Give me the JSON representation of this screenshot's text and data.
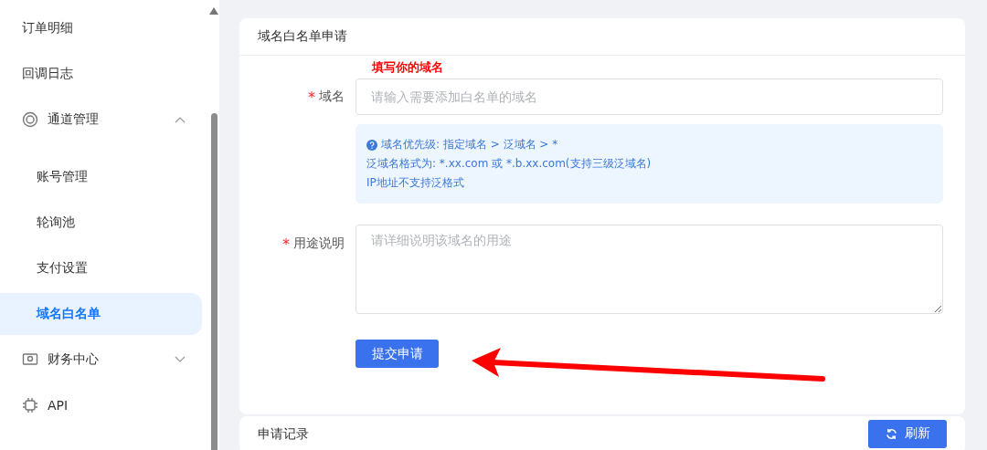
{
  "sidebar": {
    "items": [
      {
        "kind": "link",
        "label": "订单明细",
        "selected": false
      },
      {
        "kind": "link",
        "label": "回调日志",
        "selected": false
      },
      {
        "kind": "group",
        "label": "通道管理",
        "expanded": true,
        "children": [
          {
            "kind": "link",
            "label": "账号管理",
            "selected": false
          },
          {
            "kind": "link",
            "label": "轮询池",
            "selected": false
          },
          {
            "kind": "link",
            "label": "支付设置",
            "selected": false
          },
          {
            "kind": "link",
            "label": "域名白名单",
            "selected": true
          }
        ]
      },
      {
        "kind": "group",
        "label": "财务中心",
        "expanded": false
      },
      {
        "kind": "group",
        "label": "API"
      }
    ]
  },
  "form_card": {
    "title": "域名白名单申请",
    "annotation": "填写你的域名",
    "fields": [
      {
        "kind": "input",
        "label": "域名",
        "required_mark": "*",
        "placeholder": "请输入需要添加白名单的域名"
      },
      {
        "kind": "textarea",
        "label": "用途说明",
        "required_mark": "*",
        "placeholder": "请详细说明该域名的用途"
      }
    ],
    "info": [
      "域名优先级: 指定域名 > 泛域名 > *",
      "泛域名格式为: *.xx.com 或 *.b.xx.com(支持三级泛域名)",
      "IP地址不支持泛格式"
    ],
    "submit": "提交申请"
  },
  "records_card": {
    "title": "申请记录",
    "refresh": "刷新"
  }
}
